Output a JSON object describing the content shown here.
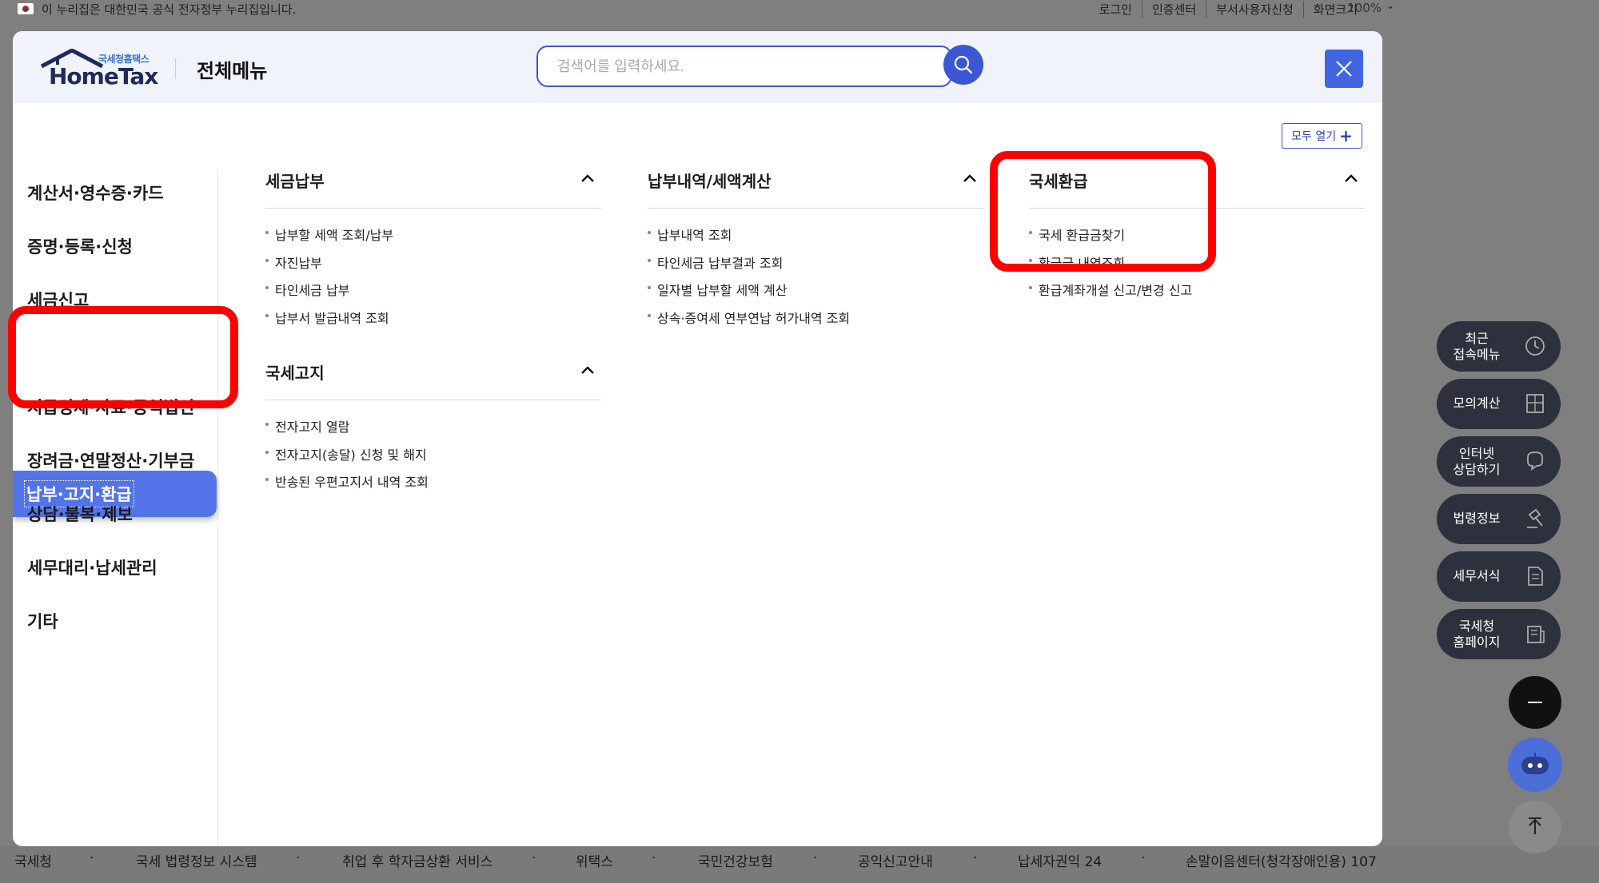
{
  "topbar": {
    "gov_notice": "이 누리집은 대한민국 공식 전자정부 누리집입니다.",
    "links": [
      "로그인",
      "인증센터",
      "부서사용자신청",
      "화면크기"
    ],
    "zoom": "100%"
  },
  "header": {
    "logo_small": "국세청홈택스",
    "logo_big": "HomeTax",
    "title": "전체메뉴",
    "search_placeholder": "검색어를 입력하세요.",
    "open_all_label": "모두 열기"
  },
  "left_nav": [
    "계산서·영수증·카드",
    "증명·등록·신청",
    "세금신고",
    "납부·고지·환급",
    "지급명세·자료·공익법인",
    "장려금·연말정산·기부금",
    "상담·불복·제보",
    "세무대리·납세관리",
    "기타"
  ],
  "active_nav": "납부·고지·환급",
  "sections": {
    "tax_payment": {
      "title": "세금납부",
      "items": [
        "납부할 세액 조회/납부",
        "자진납부",
        "타인세금 납부",
        "납부서 발급내역 조회"
      ]
    },
    "tax_notice": {
      "title": "국세고지",
      "items": [
        "전자고지 열람",
        "전자고지(송달) 신청 및 해지",
        "반송된 우편고지서 내역 조회"
      ]
    },
    "payment_history": {
      "title": "납부내역/세액계산",
      "items": [
        "납부내역 조회",
        "타인세금 납부결과 조회",
        "일자별 납부할 세액 계산",
        "상속·증여세 연부연납 허가내역 조회"
      ]
    },
    "refund": {
      "title": "국세환급",
      "items": [
        "국세 환급금찾기",
        "환급금 내역조회",
        "환급계좌개설 신고/변경 신고"
      ]
    }
  },
  "dock": [
    {
      "label": "최근\n접속메뉴",
      "icon": "clock-icon"
    },
    {
      "label": "모의계산",
      "icon": "calculator-icon"
    },
    {
      "label": "인터넷\n상담하기",
      "icon": "chat-icon"
    },
    {
      "label": "법령정보",
      "icon": "gavel-icon"
    },
    {
      "label": "세무서식",
      "icon": "document-icon"
    },
    {
      "label": "국세청\n홈페이지",
      "icon": "building-icon"
    }
  ],
  "footer": [
    "국세청",
    "국세 법령정보 시스템",
    "취업 후 학자금상환 서비스",
    "위택스",
    "국민건강보험",
    "공익신고안내",
    "납세자권익 24",
    "손말이음센터(청각장애인용) 107"
  ],
  "colors": {
    "primary": "#3b57d4",
    "active_nav": "#5374e8",
    "highlight": "#ff0000",
    "dock": "#2c313d"
  }
}
